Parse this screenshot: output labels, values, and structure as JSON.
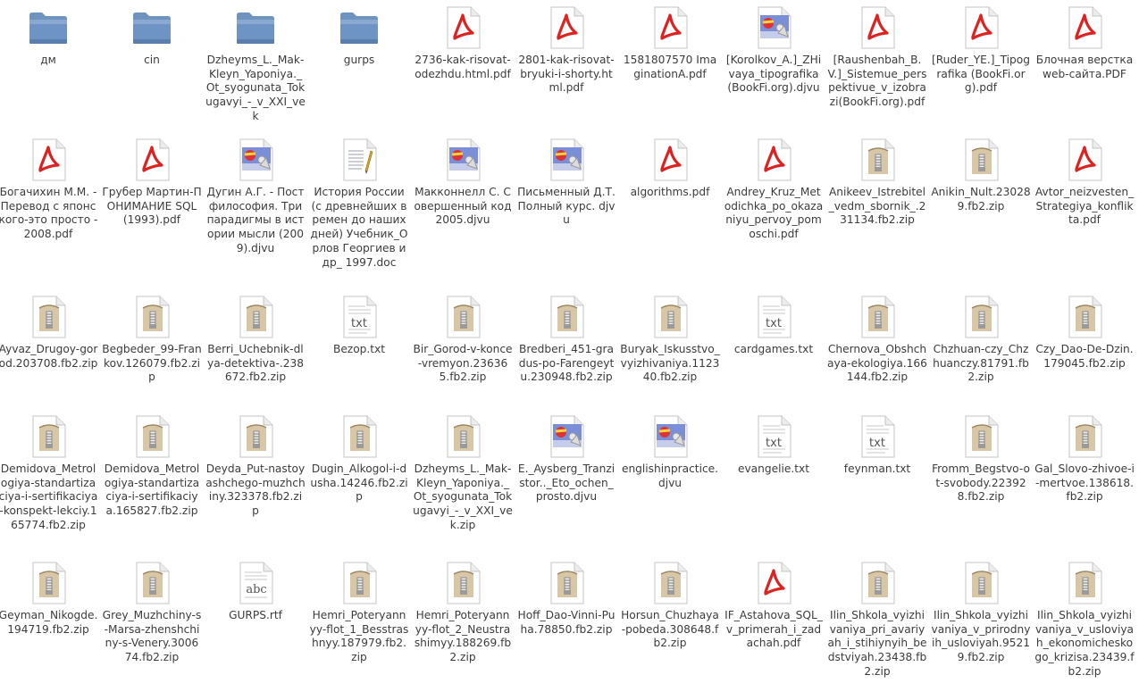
{
  "files": [
    {
      "type": "folder",
      "icon": "folder-icon",
      "name": "дм"
    },
    {
      "type": "folder",
      "icon": "folder-icon",
      "name": "cin"
    },
    {
      "type": "folder",
      "icon": "folder-icon",
      "name": "Dzheyms_L._Mak-Kleyn_Yaponiya._Ot_syogunata_Tokugavyi_-_v_XXI_vek"
    },
    {
      "type": "folder",
      "icon": "folder-icon",
      "name": "gurps"
    },
    {
      "type": "pdf",
      "icon": "pdf-icon",
      "name": "2736-kak-risovat-odezhdu.html.pdf"
    },
    {
      "type": "pdf",
      "icon": "pdf-icon",
      "name": "2801-kak-risovat-bryuki-i-shorty.html.pdf"
    },
    {
      "type": "pdf",
      "icon": "pdf-icon",
      "name": "1581807570 ImaginationA.pdf"
    },
    {
      "type": "djvu",
      "icon": "djvu-image-icon",
      "name": "[Korolkov_A.]_ZHivaya_tipografika (BookFi.org).djvu"
    },
    {
      "type": "pdf",
      "icon": "pdf-icon",
      "name": "[Raushenbah_B.V.]_Sistemue_perspektivue_v_izobrazi(BookFi.org).pdf"
    },
    {
      "type": "pdf",
      "icon": "pdf-icon",
      "name": "[Ruder_YE.]_Tipografika (BookFi.org).pdf"
    },
    {
      "type": "pdf",
      "icon": "pdf-icon",
      "name": "Блочная верстка web-сайта.PDF"
    },
    {
      "type": "pdf",
      "icon": "pdf-icon",
      "name": "Богачихин М.М. - Перевод с японского-это просто - 2008.pdf"
    },
    {
      "type": "pdf",
      "icon": "pdf-icon",
      "name": "Грубер Мартин-ПОНИМАНИЕ SQL (1993).pdf"
    },
    {
      "type": "djvu",
      "icon": "djvu-image-icon",
      "name": "Дугин А.Г. - Постфилософия. Три парадигмы в истории мысли (2009).djvu"
    },
    {
      "type": "doc",
      "icon": "document-icon",
      "name": "История России (с древнейших времен до наших дней) Учебник_Орлов Георгиев и др_ 1997.doc"
    },
    {
      "type": "djvu",
      "icon": "djvu-image-icon",
      "name": "Макконнелл С. Совершенный код  2005.djvu"
    },
    {
      "type": "djvu",
      "icon": "djvu-image-icon",
      "name": "Письменный Д.Т. Полный курс. djvu"
    },
    {
      "type": "pdf",
      "icon": "pdf-icon",
      "name": "algorithms.pdf"
    },
    {
      "type": "pdf",
      "icon": "pdf-icon",
      "name": "Andrey_Kruz_Metodichka_po_okazaniyu_pervoy_pomoschi.pdf"
    },
    {
      "type": "zip",
      "icon": "archive-icon",
      "name": "Anikeev_Istrebitel_vedm_sbornik_.231134.fb2.zip"
    },
    {
      "type": "zip",
      "icon": "archive-icon",
      "name": "Anikin_Nult.230289.fb2.zip"
    },
    {
      "type": "pdf",
      "icon": "pdf-icon",
      "name": "Avtor_neizvesten_Strategiya_konflikta.pdf"
    },
    {
      "type": "zip",
      "icon": "archive-icon",
      "name": "Ayvaz_Drugoy-gorod.203708.fb2.zip"
    },
    {
      "type": "zip",
      "icon": "archive-icon",
      "name": "Begbeder_99-Frankov.126079.fb2.zip"
    },
    {
      "type": "zip",
      "icon": "archive-icon",
      "name": "Berri_Uchebnik-dlya-detektiva-.238672.fb2.zip"
    },
    {
      "type": "txt",
      "icon": "text-file-icon",
      "name": "Bezop.txt"
    },
    {
      "type": "zip",
      "icon": "archive-icon",
      "name": "Bir_Gorod-v-konce-vremyon.236365.fb2.zip"
    },
    {
      "type": "zip",
      "icon": "archive-icon",
      "name": "Bredberi_451-gradus-po-Farengeytu.230948.fb2.zip"
    },
    {
      "type": "zip",
      "icon": "archive-icon",
      "name": "Buryak_Iskusstvo_vyizhivaniya.112340.fb2.zip"
    },
    {
      "type": "txt",
      "icon": "text-file-icon",
      "name": "cardgames.txt"
    },
    {
      "type": "zip",
      "icon": "archive-icon",
      "name": "Chernova_Obshchaya-ekologiya.166144.fb2.zip"
    },
    {
      "type": "zip",
      "icon": "archive-icon",
      "name": "Chzhuan-czy_Chzhuanczy.81791.fb2.zip"
    },
    {
      "type": "zip",
      "icon": "archive-icon",
      "name": "Czy_Dao-De-Dzin.179045.fb2.zip"
    },
    {
      "type": "zip",
      "icon": "archive-icon",
      "name": "Demidova_Metrologiya-standartizaciya-i-sertifikaciya-konspekt-lekciy.165774.fb2.zip"
    },
    {
      "type": "zip",
      "icon": "archive-icon",
      "name": "Demidova_Metrologiya-standartizaciya-i-sertifikaciya.165827.fb2.zip"
    },
    {
      "type": "zip",
      "icon": "archive-icon",
      "name": "Deyda_Put-nastoyashchego-muzhchiny.323378.fb2.zip"
    },
    {
      "type": "zip",
      "icon": "archive-icon",
      "name": "Dugin_Alkogol-i-dusha.14246.fb2.zip"
    },
    {
      "type": "zip",
      "icon": "archive-icon",
      "name": "Dzheyms_L._Mak-Kleyn_Yaponiya._Ot_syogunata_Tokugavyi_-_v_XXI_vek.zip"
    },
    {
      "type": "djvu",
      "icon": "djvu-image-icon",
      "name": "E._Aysberg_Tranzistor.._Eto_ochen_prosto.djvu"
    },
    {
      "type": "djvu",
      "icon": "djvu-image-icon",
      "name": "englishinpractice.djvu"
    },
    {
      "type": "txt",
      "icon": "text-file-icon",
      "name": "evangelie.txt"
    },
    {
      "type": "txt",
      "icon": "text-file-icon",
      "name": "feynman.txt"
    },
    {
      "type": "zip",
      "icon": "archive-icon",
      "name": "Fromm_Begstvo-ot-svobody.223928.fb2.zip"
    },
    {
      "type": "zip",
      "icon": "archive-icon",
      "name": "Gal_Slovo-zhivoe-i-mertvoe.138618.fb2.zip"
    },
    {
      "type": "zip",
      "icon": "archive-icon",
      "name": "Geyman_Nikogde.194719.fb2.zip"
    },
    {
      "type": "zip",
      "icon": "archive-icon",
      "name": "Grey_Muzhchiny-s-Marsa-zhenshchiny-s-Venery.300674.fb2.zip"
    },
    {
      "type": "rtf",
      "icon": "rtf-file-icon",
      "name": "GURPS.rtf"
    },
    {
      "type": "zip",
      "icon": "archive-icon",
      "name": "Hemri_Poteryannyy-flot_1_Besstrashnyy.187979.fb2.zip"
    },
    {
      "type": "zip",
      "icon": "archive-icon",
      "name": "Hemri_Poteryannyy-flot_2_Neustrashimyy.188269.fb2.zip"
    },
    {
      "type": "zip",
      "icon": "archive-icon",
      "name": "Hoff_Dao-Vinni-Puha.78850.fb2.zip"
    },
    {
      "type": "zip",
      "icon": "archive-icon",
      "name": "Horsun_Chuzhaya-pobeda.308648.fb2.zip"
    },
    {
      "type": "pdf",
      "icon": "pdf-icon",
      "name": "IF_Astahova_SQL_v_primerah_i_zadachah.pdf"
    },
    {
      "type": "zip",
      "icon": "archive-icon",
      "name": "Ilin_Shkola_vyizhivaniya_pri_avariyah_i_stihiynyih_bedstviyah.23438.fb2.zip"
    },
    {
      "type": "zip",
      "icon": "archive-icon",
      "name": "Ilin_Shkola_vyizhivaniya_v_prirodnyih_usloviyah.95219.fb2.zip"
    },
    {
      "type": "zip",
      "icon": "archive-icon",
      "name": "Ilin_Shkola_vyizhivaniya_v_usloviyah_ekonomicheskogo_krizisa.23439.fb2.zip"
    }
  ]
}
